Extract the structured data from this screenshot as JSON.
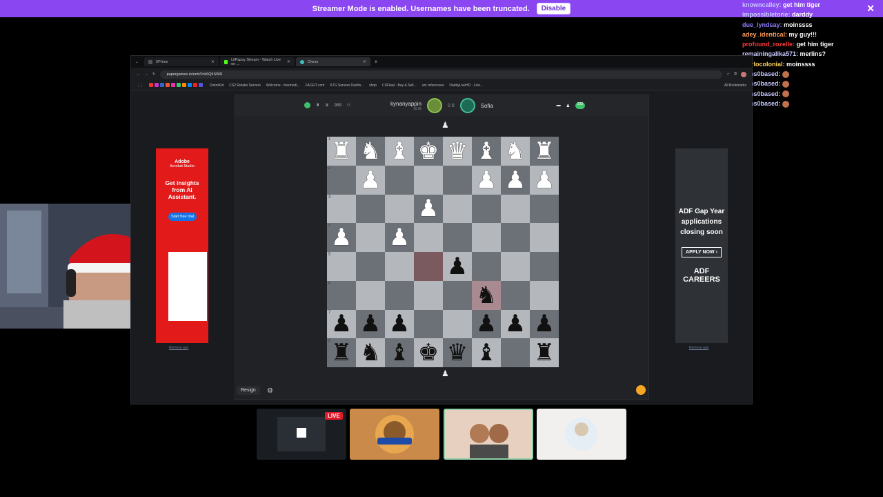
{
  "banner": {
    "message": "Streamer Mode is enabled. Usernames have been truncated.",
    "disable_label": "Disable",
    "close": "✕"
  },
  "chat": [
    {
      "user": "knowncalley:",
      "color": "#c8c8ff",
      "msg": "get him tiger"
    },
    {
      "user": "impossibletorie:",
      "color": "#c8c8ff",
      "msg": "darddy"
    },
    {
      "user": "due_lyndsay:",
      "color": "#8f7dff",
      "msg": "moinssss"
    },
    {
      "user": "adey_identical:",
      "color": "#ff9f5a",
      "msg": "my guy!!!"
    },
    {
      "user": "profound_rozelle:",
      "color": "#ff3b3b",
      "msg": "get him tiger"
    },
    {
      "user": "remainingallka571:",
      "color": "#c8c8ff",
      "msg": "merlins?"
    },
    {
      "user": "marlocolonial:",
      "color": "#ffd35a",
      "msg": "moinssss"
    },
    {
      "user": "toms0based:",
      "color": "#c8c8ff",
      "msg": ""
    },
    {
      "user": "toms0based:",
      "color": "#c8c8ff",
      "msg": ""
    },
    {
      "user": "toms0based:",
      "color": "#c8c8ff",
      "msg": ""
    },
    {
      "user": "toms0based:",
      "color": "#c8c8ff",
      "msg": ""
    }
  ],
  "browser": {
    "tabs": [
      "XPrime",
      "LilPapsy Stream - Watch Live on ...",
      "Chess"
    ],
    "new_tab": "+",
    "url": "papergames.io/en/r/0ck6Q5SWR",
    "bookmarks": [
      "DistroKid",
      "CS2 Retake Servers",
      "Welcome - freemedi...",
      "FACEIT.com",
      "K7G Servers Dashb...",
      "shop",
      "CSFloat - Buy & Sell...",
      "uni references",
      "DaddyLiveHD - Live...",
      "All Bookmarks"
    ]
  },
  "game": {
    "left_count": "999",
    "player1": "kynanyappin",
    "player1_rating": "16.0k",
    "score": "0 0",
    "player2": "Sofia",
    "right_count": "323",
    "resign_label": "Resign",
    "board": [
      [
        "wR",
        "wN",
        "wB",
        "wK",
        "wQ",
        "wB",
        "wN",
        "wR"
      ],
      [
        "",
        "wP",
        "",
        "",
        "",
        "wP",
        "wP",
        "wP"
      ],
      [
        "",
        "",
        "",
        "wP",
        "",
        "",
        "",
        ""
      ],
      [
        "wP",
        "",
        "wP",
        "",
        "",
        "",
        "",
        ""
      ],
      [
        "",
        "",
        "",
        "",
        "bP",
        "",
        "",
        ""
      ],
      [
        "",
        "",
        "",
        "",
        "",
        "bN",
        "",
        ""
      ],
      [
        "bP",
        "bP",
        "bP",
        "",
        "",
        "bP",
        "bP",
        "bP"
      ],
      [
        "bR",
        "bN",
        "bB",
        "bK",
        "bQ",
        "bB",
        "",
        "bR"
      ]
    ],
    "ranks": [
      "1",
      "2",
      "3",
      "4",
      "5",
      "6",
      "7",
      "8"
    ]
  },
  "ads": {
    "left": {
      "brand": "Adobe",
      "subtitle": "Acrobat Studio",
      "headline": "Get insights from AI Assistant.",
      "cta": "Start free trial"
    },
    "right": {
      "headline": "ADF Gap Year applications closing soon",
      "cta": "APPLY NOW ›",
      "brand": "ADF CAREERS"
    },
    "remove_label": "Remove ads"
  },
  "thumbs": {
    "live": "LIVE"
  },
  "colors": {
    "banner": "#8a46f0",
    "ad_left": "#e21a1a",
    "board_light": "#b4b7bc",
    "board_dark": "#6c7178",
    "highlight": "#a98a90"
  }
}
